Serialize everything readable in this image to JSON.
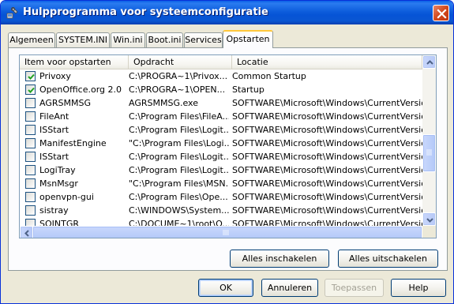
{
  "window": {
    "title": "Hulpprogramma voor systeemconfiguratie",
    "accent_color": "#0a56d2",
    "close_icon": "close-icon"
  },
  "tabs": [
    {
      "label": "Algemeen",
      "active": false
    },
    {
      "label": "SYSTEM.INI",
      "active": false
    },
    {
      "label": "Win.ini",
      "active": false
    },
    {
      "label": "Boot.ini",
      "active": false
    },
    {
      "label": "Services",
      "active": false
    },
    {
      "label": "Opstarten",
      "active": true
    }
  ],
  "list": {
    "columns": [
      "Item voor opstarten",
      "Opdracht",
      "Locatie"
    ],
    "rows": [
      {
        "checked": true,
        "item": "Privoxy",
        "command": "C:\\PROGRA~1\\Privox...",
        "location": "Common Startup"
      },
      {
        "checked": true,
        "item": "OpenOffice.org 2.0",
        "command": "C:\\PROGRA~1\\OPEN...",
        "location": "Startup"
      },
      {
        "checked": false,
        "item": "AGRSMMSG",
        "command": "AGRSMMSG.exe",
        "location": "SOFTWARE\\Microsoft\\Windows\\CurrentVersion\\Ru"
      },
      {
        "checked": false,
        "item": "FileAnt",
        "command": "C:\\Program Files\\FileA...",
        "location": "SOFTWARE\\Microsoft\\Windows\\CurrentVersion\\Ru"
      },
      {
        "checked": false,
        "item": "ISStart",
        "command": "C:\\Program Files\\Logit...",
        "location": "SOFTWARE\\Microsoft\\Windows\\CurrentVersion\\Ru"
      },
      {
        "checked": false,
        "item": "ManifestEngine",
        "command": "\"C:\\Program Files\\Logi...",
        "location": "SOFTWARE\\Microsoft\\Windows\\CurrentVersion\\Ru"
      },
      {
        "checked": false,
        "item": "ISStart",
        "command": "C:\\Program Files\\Logit...",
        "location": "SOFTWARE\\Microsoft\\Windows\\CurrentVersion\\Ru"
      },
      {
        "checked": false,
        "item": "LogiTray",
        "command": "C:\\Program Files\\Logit...",
        "location": "SOFTWARE\\Microsoft\\Windows\\CurrentVersion\\Ru"
      },
      {
        "checked": false,
        "item": "MsnMsgr",
        "command": "\"C:\\Program Files\\MSN...",
        "location": "SOFTWARE\\Microsoft\\Windows\\CurrentVersion\\Ru"
      },
      {
        "checked": false,
        "item": "openvpn-gui",
        "command": "C:\\Program Files\\Ope...",
        "location": "SOFTWARE\\Microsoft\\Windows\\CurrentVersion\\Ru"
      },
      {
        "checked": false,
        "item": "sistray",
        "command": "C:\\WINDOWS\\System...",
        "location": "SOFTWARE\\Microsoft\\Windows\\CurrentVersion\\Ru"
      },
      {
        "checked": false,
        "item": "SOINTGR",
        "command": "C:\\DOCUME~1\\root\\O...",
        "location": "SOFTWARE\\Microsoft\\Windows\\CurrentVersion\\Ru"
      }
    ]
  },
  "panel_buttons": {
    "enable_all": "Alles inschakelen",
    "disable_all": "Alles uitschakelen"
  },
  "footer_buttons": {
    "ok": "OK",
    "cancel": "Annuleren",
    "apply": "Toepassen",
    "help": "Help"
  }
}
